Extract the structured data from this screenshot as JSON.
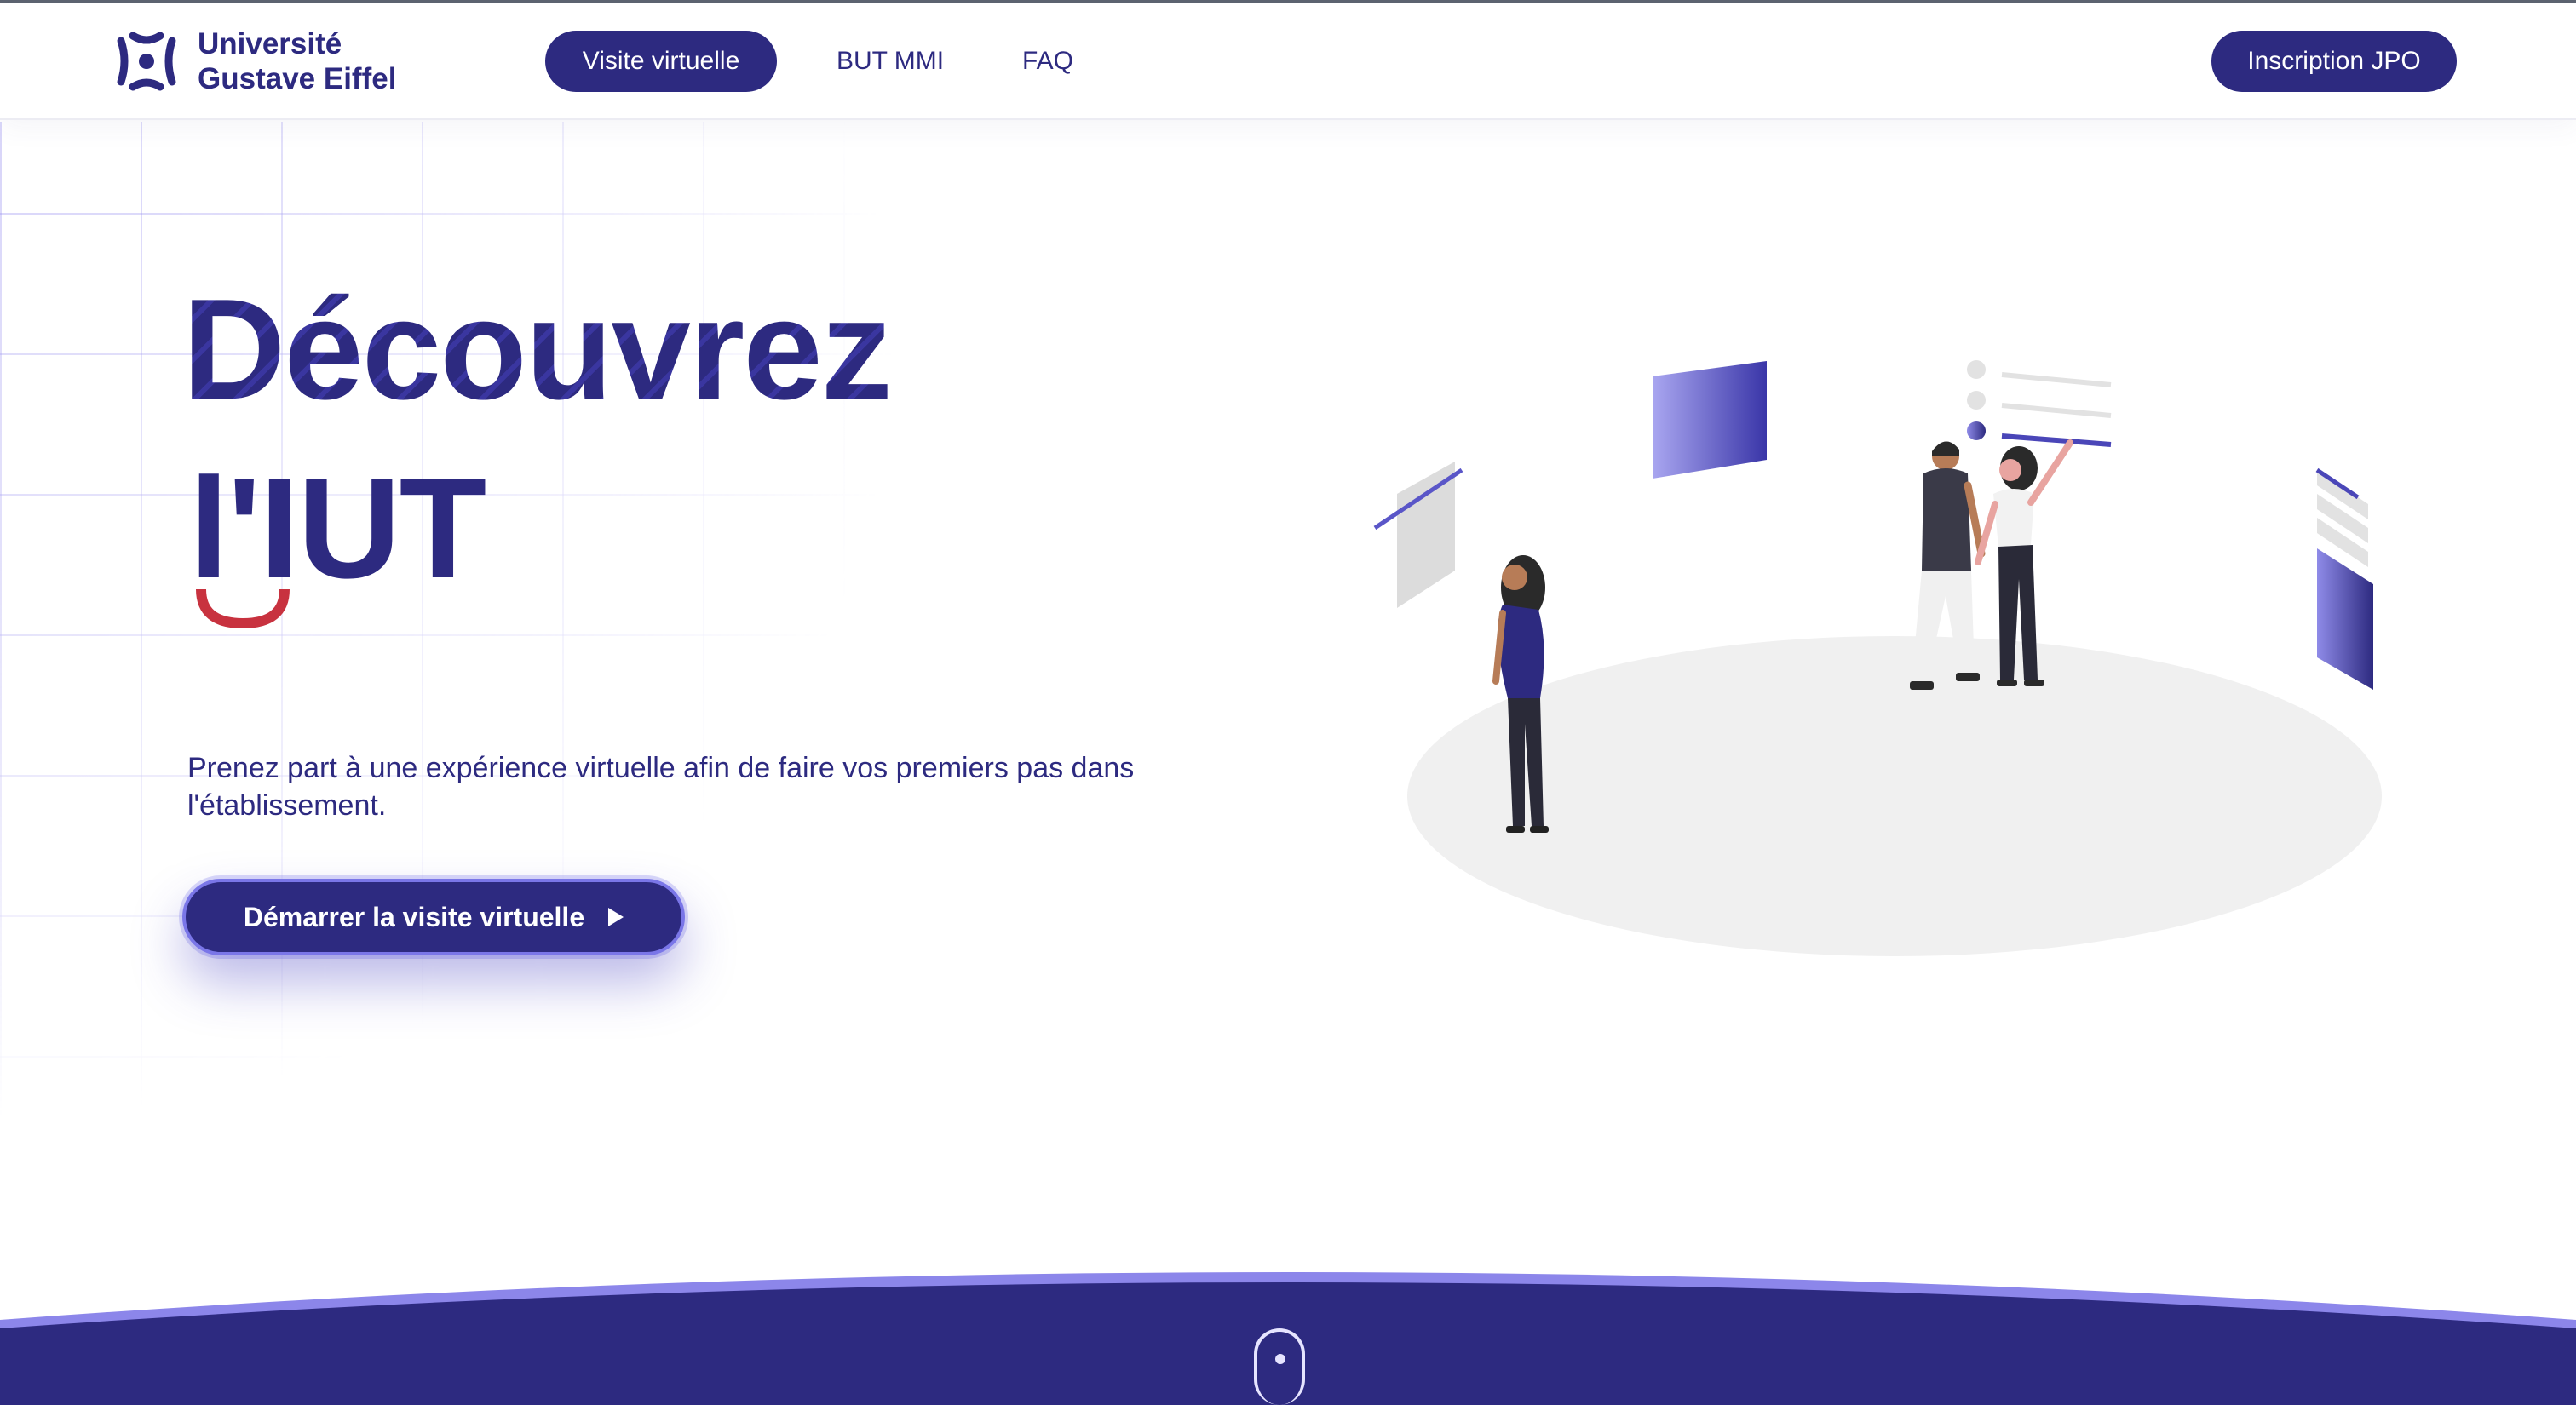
{
  "header": {
    "logo_line1": "Université",
    "logo_line2": "Gustave Eiffel",
    "nav": {
      "visit": "Visite virtuelle",
      "but": "BUT MMI",
      "faq": "FAQ"
    },
    "jpo": "Inscription JPO"
  },
  "hero": {
    "title_line1": "Découvrez",
    "title_line2": "l'IUT",
    "subtitle": "Prenez part à une expérience virtuelle afin de faire vos premiers pas dans l'établissement.",
    "cta_label": "Démarrer la visite virtuelle"
  },
  "colors": {
    "primary": "#2d2a80",
    "accent": "#7a76e8",
    "smile_red": "#c8323f",
    "floor": "#f0f0f0"
  },
  "icons": {
    "logo": "university-logo-icon",
    "cta": "play-icon",
    "scroll": "scroll-mouse-icon"
  }
}
